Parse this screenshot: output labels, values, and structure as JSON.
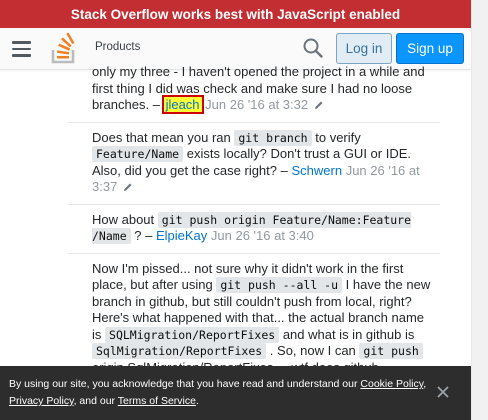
{
  "banner": {
    "text": "Stack Overflow works best with JavaScript enabled"
  },
  "header": {
    "products_label": "Products",
    "login_label": "Log in",
    "signup_label": "Sign up"
  },
  "comments": [
    {
      "text_line0": "only my three - I haven't opened the project in a while and",
      "text_rest": "first thing I did was check and make sure I had no loose branches. –",
      "user": "jleach",
      "date": "Jun 26 '16 at 3:32"
    },
    {
      "t1": "Does that mean you ran",
      "c1": "git branch",
      "t2": "to verify",
      "c2": "Feature/Name",
      "t3": "exists locally? Don't trust a GUI or IDE. Also, did you get the case right? –",
      "user": "Schwern",
      "date": "Jun 26 '16 at 3:37"
    },
    {
      "t1": "How about",
      "c1": "git push origin Feature/Name:Feature /Name",
      "t2": "? –",
      "user": "ElpieKay",
      "date": "Jun 26 '16 at 3:40"
    },
    {
      "t1": "Now I'm pissed... not sure why it didn't work in the first place, but after using",
      "c1": "git push --all -u",
      "t2": "I have the new branch in github, but still couldn't push from local, right? Here's what happened with that... the actual branch name is",
      "c2": "SQLMigration/ReportFixes",
      "t3": "and what is in github is",
      "c3": "SqlMigration/ReportFixes",
      "t4": ". So, now I can",
      "c4": "git push",
      "t5": "origin SqlMigration/ReportFixes ... wtf does github"
    }
  ],
  "cookie": {
    "t1": "By using our site, you acknowledge that you have read and understand our",
    "link1": "Cookie Policy",
    "sep1": ",",
    "link2": "Privacy Policy",
    "t2": ", and our",
    "link3": "Terms of Service",
    "t3": "."
  },
  "icons": [
    "hamburger-icon",
    "stackoverflow-logo-icon",
    "search-icon",
    "pencil-icon",
    "close-icon"
  ],
  "colors": {
    "banner": "#c22e32",
    "signup": "#0a95ff",
    "login_bg": "#e1ecf4",
    "link": "#0074cc",
    "cookie_bg": "#2d2d2d"
  }
}
